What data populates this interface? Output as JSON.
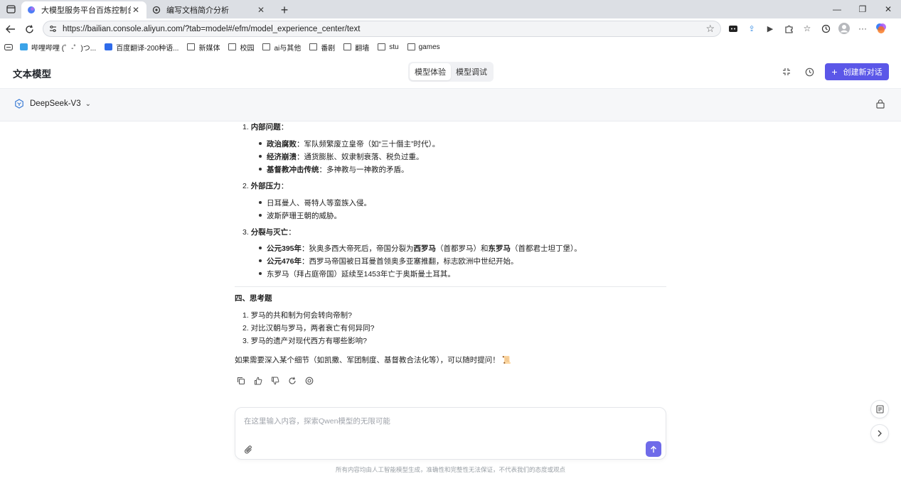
{
  "browser": {
    "tabs": [
      {
        "title": "大模型服务平台百炼控制台",
        "active": true
      },
      {
        "title": "编写文档简介分析",
        "active": false
      }
    ],
    "url": "https://bailian.console.aliyun.com/?tab=model#/efm/model_experience_center/text",
    "bookmarks": [
      "哔哩哔哩 (゜-゜)つ...",
      "百度翻译-200种语...",
      "新媒体",
      "校园",
      "ai与其他",
      "番剧",
      "翻墙",
      "stu",
      "games"
    ]
  },
  "app": {
    "title": "文本模型",
    "mode_tabs": [
      "模型体验",
      "模型调试"
    ],
    "new_chat_label": "创建新对话",
    "model_name": "DeepSeek-V3",
    "accent_color": "#5b57e8"
  },
  "chat": {
    "s1": {
      "num": "1.",
      "title": "内部问题",
      "items": [
        {
          "bold": "政治腐败",
          "text": "：军队频繁废立皇帝（如“三十僭主”时代）。"
        },
        {
          "bold": "经济崩溃",
          "text": "：通货膨胀、奴隶制衰落、税负过重。"
        },
        {
          "bold": "基督教冲击传统",
          "text": "：多神教与一神教的矛盾。"
        }
      ]
    },
    "s2": {
      "num": "2.",
      "title": "外部压力",
      "items": [
        "日耳曼人、哥特人等蛮族入侵。",
        "波斯萨珊王朝的威胁。"
      ]
    },
    "s3": {
      "num": "3.",
      "title": "分裂与灭亡",
      "item1": {
        "bold": "公元395年",
        "t1": "：狄奥多西大帝死后，帝国分裂为",
        "b2": "西罗马",
        "t2": "（首都罗马）和",
        "b3": "东罗马",
        "t3": "（首都君士坦丁堡）。"
      },
      "item2": {
        "bold": "公元476年",
        "text": "：西罗马帝国被日耳曼首领奥多亚塞推翻，标志欧洲中世纪开始。"
      },
      "item3": "东罗马（拜占庭帝国）延续至1453年亡于奥斯曼土耳其。"
    },
    "section4_title": "四、思考题",
    "questions": [
      "1. 罗马的共和制为何会转向帝制?",
      "2. 对比汉朝与罗马，两者衰亡有何异同?",
      "3. 罗马的遗产对现代西方有哪些影响?"
    ],
    "closing": "如果需要深入某个细节（如凯撒、军团制度、基督教合法化等），可以随时提问！",
    "closing_emoji": "📜"
  },
  "input": {
    "placeholder": "在这里输入内容，探索Qwen模型的无限可能"
  },
  "footer_note": "所有内容均由人工智能模型生成，准确性和完整性无法保证，不代表我们的态度或观点"
}
